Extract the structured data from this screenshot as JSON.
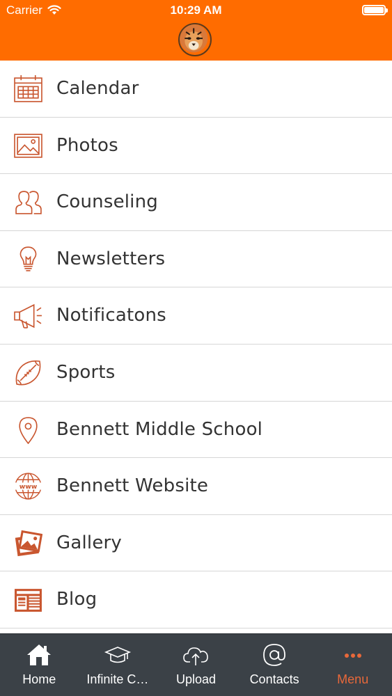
{
  "status_bar": {
    "carrier": "Carrier",
    "time": "10:29 AM"
  },
  "colors": {
    "header": "#ff6c00",
    "icon_accent": "#c9562f",
    "tabbar": "#3b4147",
    "active_tab": "#e8683a"
  },
  "menu": {
    "items": [
      {
        "label": "Calendar",
        "icon": "calendar-icon"
      },
      {
        "label": "Photos",
        "icon": "photo-icon"
      },
      {
        "label": "Counseling",
        "icon": "people-icon"
      },
      {
        "label": "Newsletters",
        "icon": "lightbulb-icon"
      },
      {
        "label": "Notificatons",
        "icon": "megaphone-icon"
      },
      {
        "label": "Sports",
        "icon": "football-icon"
      },
      {
        "label": "Bennett Middle School",
        "icon": "map-pin-icon"
      },
      {
        "label": "Bennett Website",
        "icon": "globe-www-icon"
      },
      {
        "label": "Gallery",
        "icon": "gallery-icon"
      },
      {
        "label": "Blog",
        "icon": "newspaper-icon"
      }
    ]
  },
  "tabbar": {
    "tabs": [
      {
        "label": "Home",
        "icon": "home-icon"
      },
      {
        "label": "Infinite C…",
        "icon": "graduation-cap-icon"
      },
      {
        "label": "Upload",
        "icon": "cloud-upload-icon"
      },
      {
        "label": "Contacts",
        "icon": "at-sign-icon"
      },
      {
        "label": "Menu",
        "icon": "more-dots-icon",
        "active": true
      }
    ]
  }
}
